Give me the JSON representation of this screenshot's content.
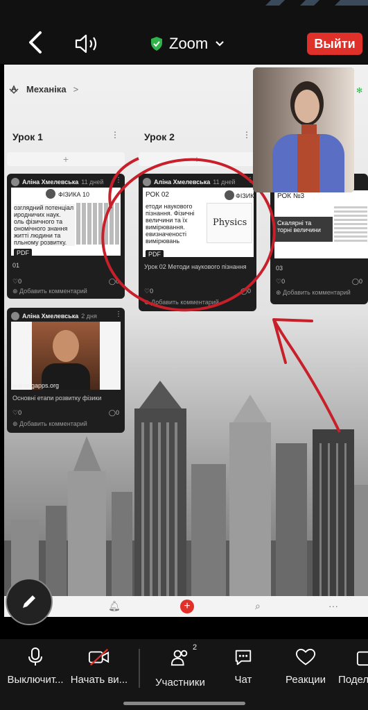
{
  "zoom": {
    "title": "Zoom",
    "leave_label": "Выйти",
    "colors": {
      "leave": "#e0302a",
      "shield": "#2fb34a"
    }
  },
  "padlet": {
    "breadcrumb": {
      "title": "Механіка",
      "sep": ">"
    },
    "columns": [
      {
        "title": "Урок 1",
        "add": "+"
      },
      {
        "title": "Урок 2",
        "add": "+"
      }
    ],
    "cards": [
      {
        "author": "Аліна Хмелевська",
        "ago": "11 дней",
        "thumb_badge": "ФІЗИКА 10",
        "thumb_lines": [
          "озглядний потенціал",
          "иродничих наук.",
          "оль фізичного та",
          "ономічного знання",
          "житті людини та",
          "пльному розвитку."
        ],
        "tag": "PDF",
        "title": "01",
        "likes": "0",
        "comments": "0",
        "add_comment": "Добавить комментарий"
      },
      {
        "author": "Аліна Хмелевська",
        "ago": "11 дней",
        "thumb_heading": "РОК 02",
        "thumb_badge": "ФІЗИК",
        "thumb_lines": [
          "етоди наукового",
          "пізнання. Фізичні",
          "величини та їх",
          "вимірювання.",
          "евизначеності",
          "вимірювань"
        ],
        "thumb_word": "Physics",
        "tag": "PDF",
        "title": "Урок 02 Методи наукового пізнання",
        "likes": "0",
        "comments": "0",
        "add_comment": "Добавить комментарий"
      },
      {
        "author": "",
        "ago": "",
        "thumb_heading": "РОК №3",
        "thumb_lines": [
          "Скалярні та",
          "торні величини"
        ],
        "title": "03",
        "likes": "0",
        "comments": "0",
        "add_comment": "Добавить комментарий"
      },
      {
        "author": "Аліна Хмелевська",
        "ago": "2 дня",
        "thumb_caption": "learningapps.org",
        "title": "Основні етапи розвитку фізики",
        "likes": "0",
        "comments": "0",
        "add_comment": "Добавить комментарий"
      }
    ]
  },
  "bottom": {
    "items": [
      {
        "label": "Выключит...",
        "icon": "microphone-icon"
      },
      {
        "label": "Начать ви...",
        "icon": "video-off-icon"
      },
      {
        "label": "Участники",
        "icon": "participants-icon",
        "badge": "2"
      },
      {
        "label": "Чат",
        "icon": "chat-icon"
      },
      {
        "label": "Реакции",
        "icon": "heart-icon"
      },
      {
        "label": "Подел",
        "icon": "share-icon"
      }
    ]
  }
}
